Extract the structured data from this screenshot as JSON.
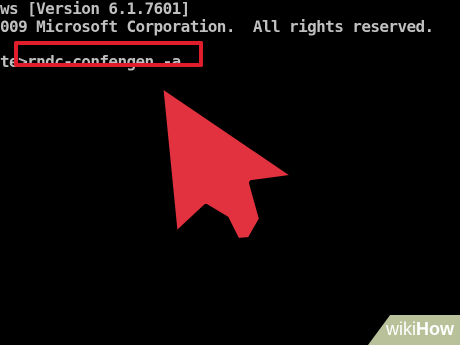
{
  "console": {
    "line1": "ws [Version 6.1.7601]",
    "line2": "009 Microsoft Corporation.  All rights reserved.",
    "prompt": "te>",
    "command": "rndc-confengen -a"
  },
  "highlight": {
    "color": "#e01e2b"
  },
  "arrow": {
    "icon": "pointer-arrow-icon",
    "fill": "#e2323f",
    "stroke": "#000000"
  },
  "watermark": {
    "prefix": "wiki",
    "brand": "How"
  }
}
